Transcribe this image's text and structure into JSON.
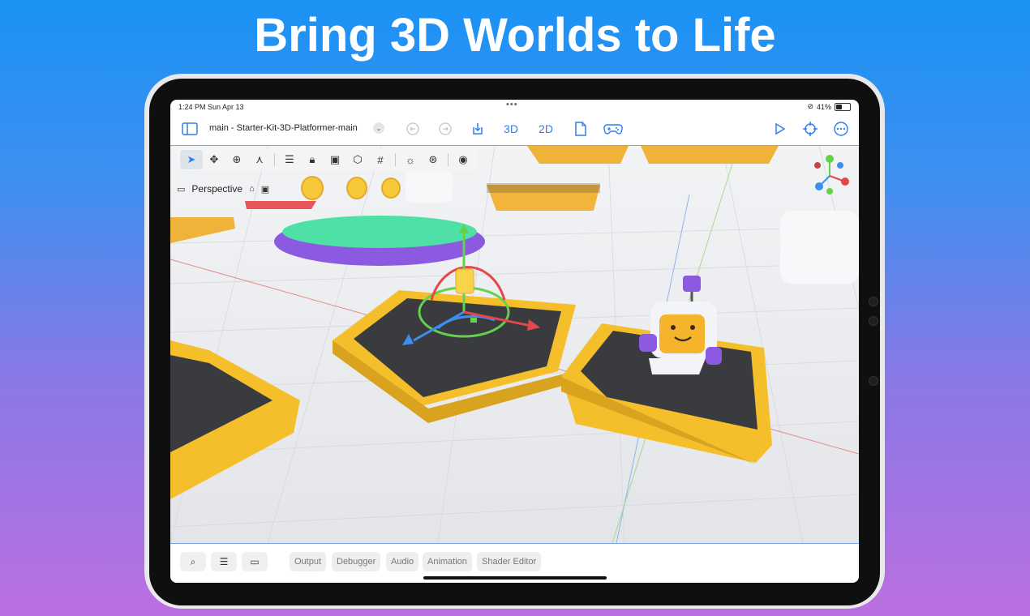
{
  "headline": "Bring 3D Worlds to Life",
  "status_bar": {
    "time": "1:24 PM   Sun Apr 13",
    "dots": "•••",
    "battery": "41%",
    "battery_level": 0.41
  },
  "toolbar": {
    "scene_title": "main - Starter-Kit-3D-Platformer-main",
    "mode_3d": "3D",
    "mode_2d": "2D"
  },
  "viewport": {
    "camera_label": "Perspective",
    "tools": [
      "select",
      "move",
      "rotate",
      "scale",
      "list",
      "lock",
      "group",
      "mesh",
      "grid",
      "sun",
      "environment",
      "animation"
    ]
  },
  "bottom_panel": {
    "tabs": [
      "Output",
      "Debugger",
      "Audio",
      "Animation",
      "Shader Editor"
    ]
  },
  "colors": {
    "accent": "#2f7ef0",
    "platform_yellow": "#f5bf2c",
    "platform_dark": "#3a3b3f",
    "island_green": "#4fe0a6",
    "island_purple": "#8c5ae0"
  }
}
